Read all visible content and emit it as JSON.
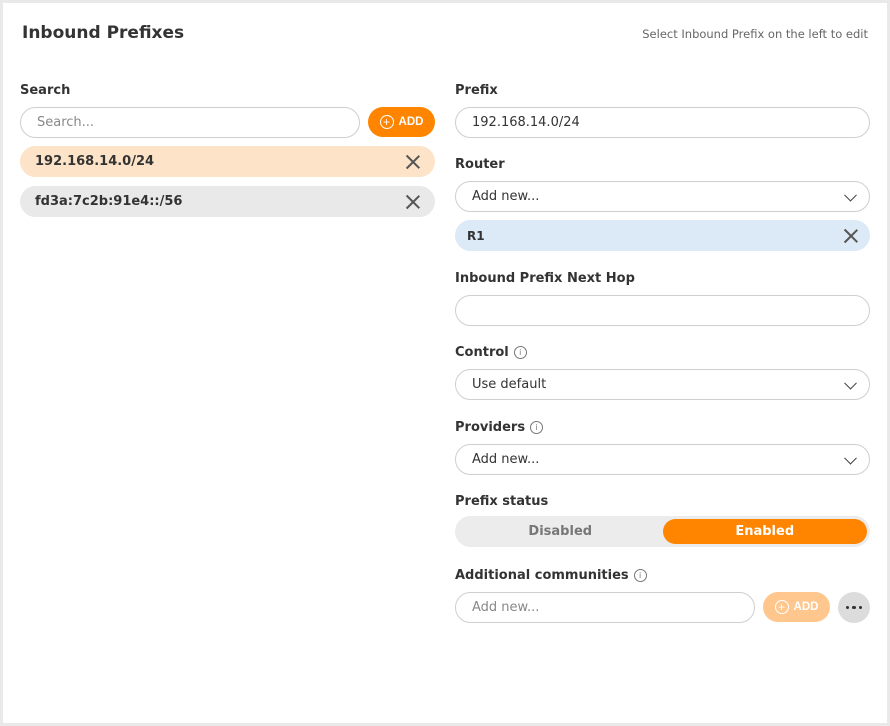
{
  "header": {
    "title": "Inbound Prefixes",
    "hint": "Select Inbound Prefix on the left to edit"
  },
  "left": {
    "search_label": "Search",
    "search_placeholder": "Search...",
    "add_label": "ADD",
    "prefixes": [
      {
        "value": "192.168.14.0/24",
        "selected": true
      },
      {
        "value": "fd3a:7c2b:91e4::/56",
        "selected": false
      }
    ]
  },
  "form": {
    "prefix": {
      "label": "Prefix",
      "value": "192.168.14.0/24"
    },
    "router": {
      "label": "Router",
      "placeholder": "Add new...",
      "chips": [
        "R1"
      ]
    },
    "next_hop": {
      "label": "Inbound Prefix Next Hop",
      "value": ""
    },
    "control": {
      "label": "Control",
      "value": "Use default"
    },
    "providers": {
      "label": "Providers",
      "placeholder": "Add new..."
    },
    "status": {
      "label": "Prefix status",
      "options": [
        "Disabled",
        "Enabled"
      ],
      "selected": "Enabled"
    },
    "communities": {
      "label": "Additional communities",
      "placeholder": "Add new...",
      "add_label": "ADD"
    }
  },
  "icons": {
    "info": "info-icon",
    "remove": "close-icon",
    "chevron": "chevron-down-icon",
    "add": "plus-circle-icon",
    "more": "more-horizontal-icon"
  },
  "colors": {
    "accent": "#ff8400",
    "accent_light": "#ffc78d",
    "selected_row": "#fde3c7",
    "chip": "#dce9f7"
  }
}
